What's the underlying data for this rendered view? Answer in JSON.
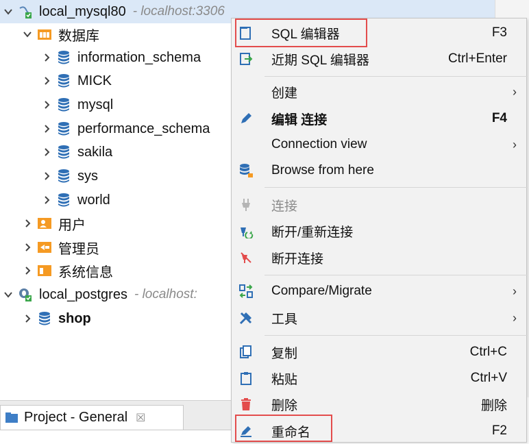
{
  "tree": {
    "connection1": {
      "name": "local_mysql80",
      "host": "- localhost:3306"
    },
    "databases_folder": "数据库",
    "databases": [
      "information_schema",
      "MICK",
      "mysql",
      "performance_schema",
      "sakila",
      "sys",
      "world"
    ],
    "users": "用户",
    "admins": "管理员",
    "sysinfo": "系统信息",
    "connection2": {
      "name": "local_postgres",
      "host": "- localhost:"
    },
    "pg_db": "shop"
  },
  "project_tab": {
    "label": "Project - General",
    "close": "☒"
  },
  "menu": {
    "items": {
      "sql_editor": {
        "label": "SQL 编辑器",
        "shortcut": "F3"
      },
      "recent_sql_editor": {
        "label": "近期 SQL 编辑器",
        "shortcut": "Ctrl+Enter"
      },
      "create": {
        "label": "创建",
        "arrow": "›"
      },
      "edit_connection": {
        "label": "编辑 连接",
        "shortcut": "F4"
      },
      "connection_view": {
        "label": "Connection view",
        "arrow": "›"
      },
      "browse": {
        "label": "Browse from here"
      },
      "connect": {
        "label": "连接"
      },
      "reconnect": {
        "label": "断开/重新连接"
      },
      "disconnect": {
        "label": "断开连接"
      },
      "compare": {
        "label": "Compare/Migrate",
        "arrow": "›"
      },
      "tools": {
        "label": "工具",
        "arrow": "›"
      },
      "copy": {
        "label": "复制",
        "shortcut": "Ctrl+C"
      },
      "paste": {
        "label": "粘贴",
        "shortcut": "Ctrl+V"
      },
      "delete": {
        "label": "删除",
        "shortcut": "删除"
      },
      "rename": {
        "label": "重命名",
        "shortcut": "F2"
      }
    }
  },
  "colors": {
    "selection": "#dbe8f7",
    "db_icon": "#2f6fb5",
    "highlight_box": "#e34c4c",
    "folder_orange": "#f59a23"
  }
}
